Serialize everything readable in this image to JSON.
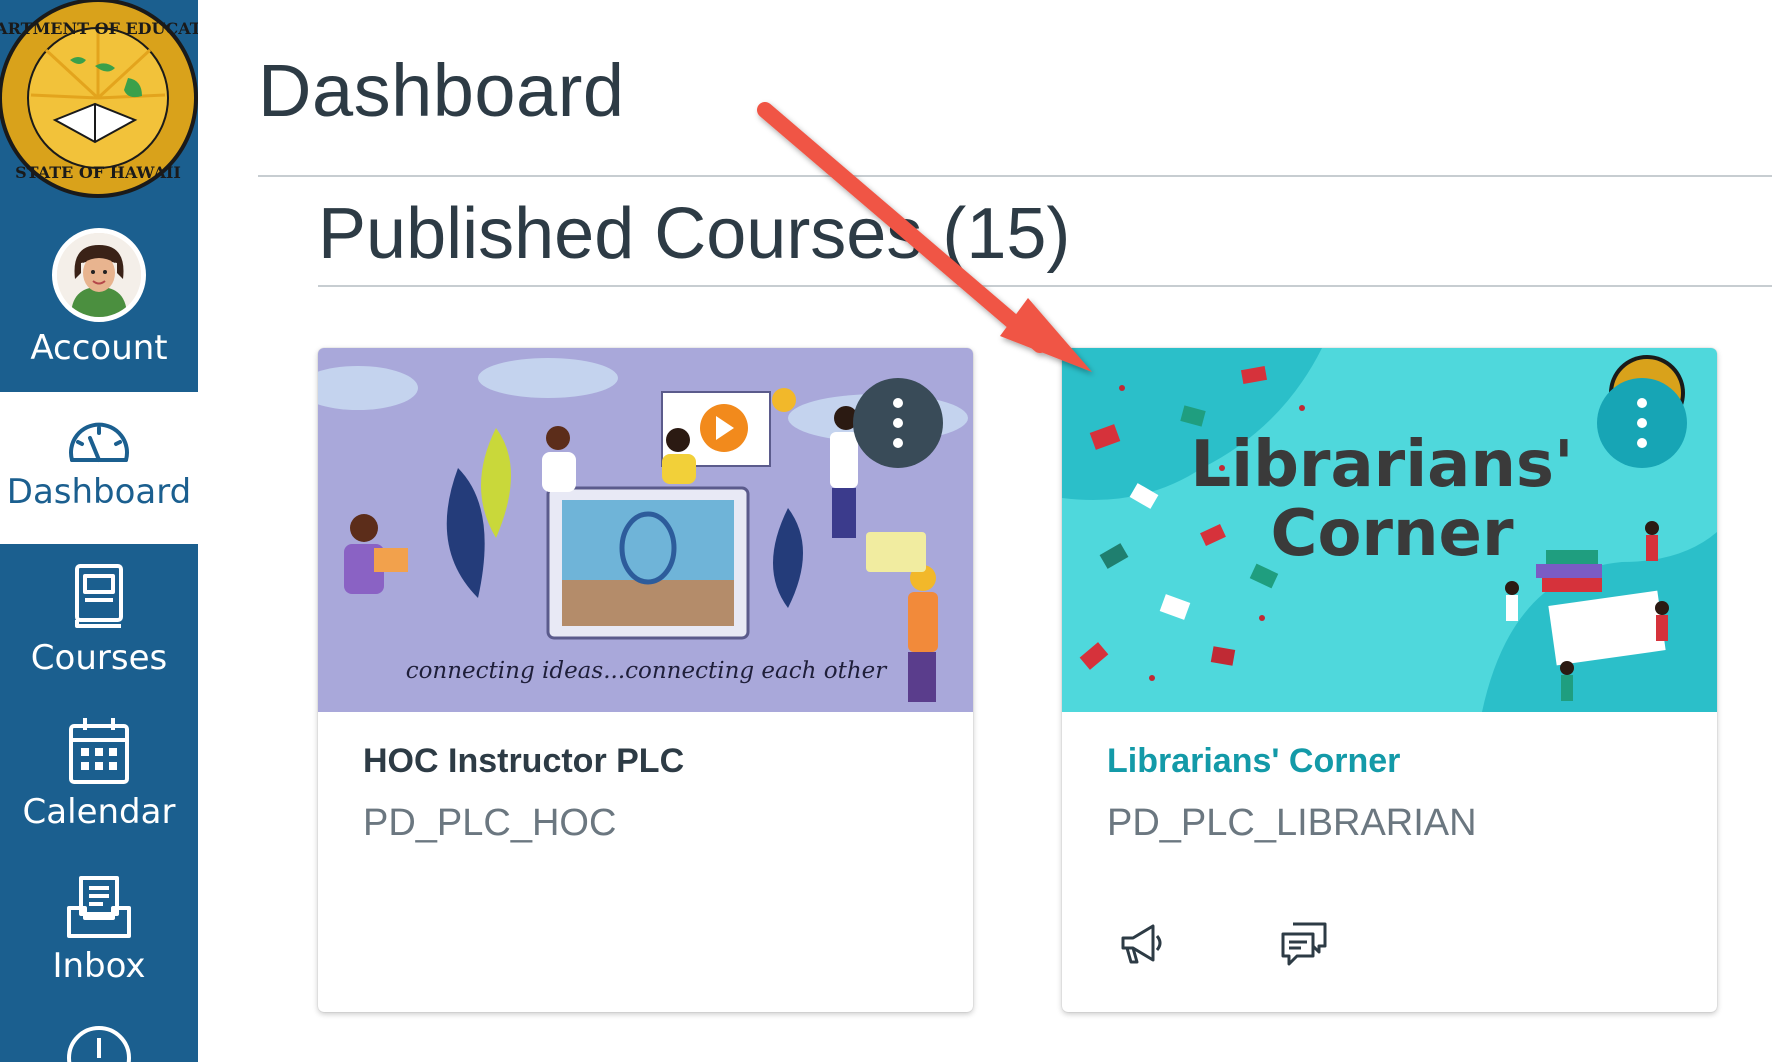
{
  "nav": {
    "logo": {
      "seal_text_top": "DEPARTMENT OF EDUCATION",
      "seal_text_bottom": "STATE OF HAWAII"
    },
    "items": [
      {
        "label": "Account",
        "icon": "avatar"
      },
      {
        "label": "Dashboard",
        "icon": "speedometer-icon",
        "active": true
      },
      {
        "label": "Courses",
        "icon": "book-icon"
      },
      {
        "label": "Calendar",
        "icon": "calendar-icon"
      },
      {
        "label": "Inbox",
        "icon": "inbox-icon"
      }
    ]
  },
  "main": {
    "title": "Dashboard",
    "section_title": "Published Courses (15)"
  },
  "courses": [
    {
      "name": "HOC Instructor PLC",
      "code": "PD_PLC_HOC",
      "hero_caption": "connecting ideas...connecting each other",
      "hero_color": "#a8a6d8"
    },
    {
      "name": "Librarians' Corner",
      "code": "PD_PLC_LIBRARIAN",
      "hero_line1": "Librarians'",
      "hero_line2": "Corner",
      "hero_color": "#4fd8dc",
      "actions": [
        "announcements-icon",
        "discussions-icon"
      ]
    }
  ],
  "colors": {
    "nav_bg": "#1b5f8f",
    "card1_accent": "#394b58",
    "card2_accent": "#139aa8",
    "annotation_arrow": "#f05545"
  }
}
